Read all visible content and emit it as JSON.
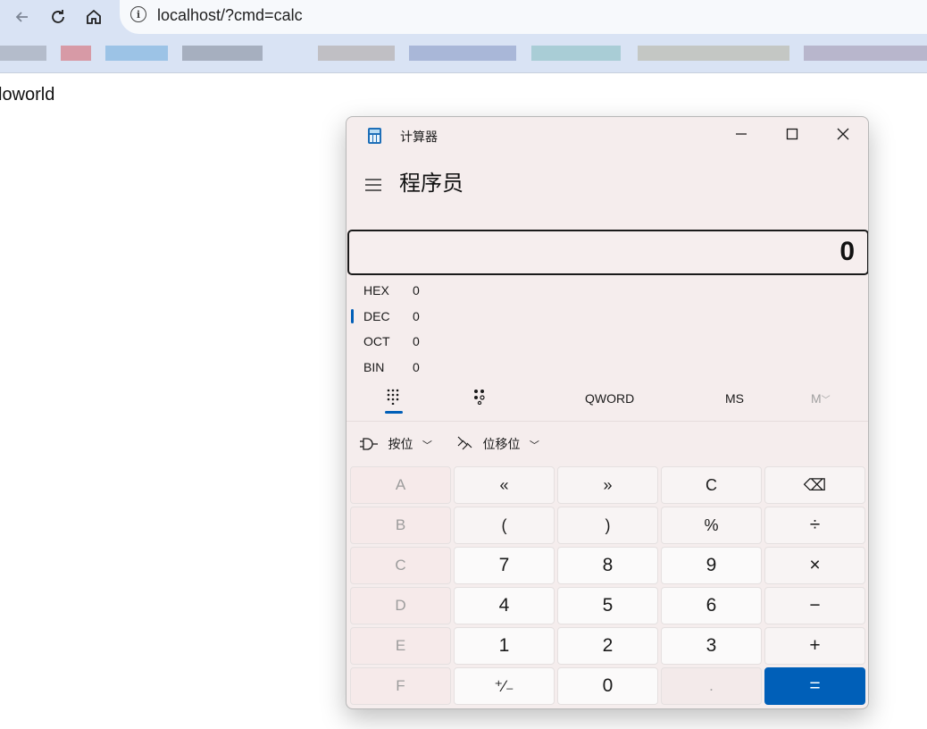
{
  "browser": {
    "url": "localhost/?cmd=calc",
    "back_icon": "arrow-left-icon",
    "reload_icon": "reload-icon",
    "home_icon": "home-icon",
    "info_icon": "info-icon"
  },
  "page": {
    "text": "loworld"
  },
  "calculator": {
    "title": "计算器",
    "mode": "程序员",
    "display": "0",
    "radix": [
      {
        "label": "HEX",
        "value": "0"
      },
      {
        "label": "DEC",
        "value": "0"
      },
      {
        "label": "OCT",
        "value": "0"
      },
      {
        "label": "BIN",
        "value": "0"
      }
    ],
    "tools": {
      "word_size": "QWORD",
      "memory_store": "MS",
      "memory": "M"
    },
    "dropdowns": {
      "bitwise": "按位",
      "bitshift": "位移位"
    },
    "keys": [
      [
        "A",
        "«",
        "»",
        "C",
        "⌫"
      ],
      [
        "B",
        "(",
        ")",
        "%",
        "÷"
      ],
      [
        "C",
        "7",
        "8",
        "9",
        "×"
      ],
      [
        "D",
        "4",
        "5",
        "6",
        "−"
      ],
      [
        "E",
        "1",
        "2",
        "3",
        "+"
      ],
      [
        "F",
        "⁺∕₋",
        "0",
        ".",
        "="
      ]
    ],
    "accent": "#005fb8"
  }
}
